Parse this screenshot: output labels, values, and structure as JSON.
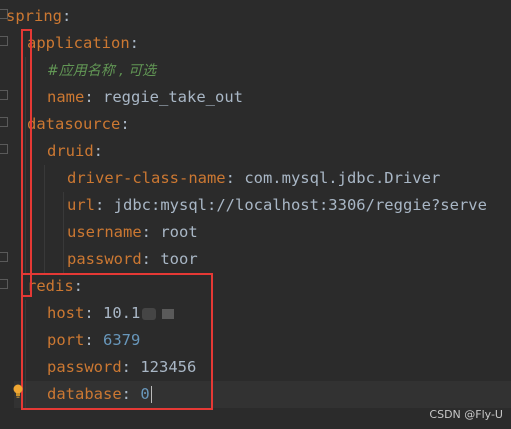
{
  "lines": {
    "spring": {
      "key": "spring",
      "sep": ":"
    },
    "application": {
      "key": "application",
      "sep": ":"
    },
    "comment": "#应用名称 , 可选",
    "name": {
      "key": "name",
      "sep": ": ",
      "value": "reggie_take_out"
    },
    "datasource": {
      "key": "datasource",
      "sep": ":"
    },
    "druid": {
      "key": "druid",
      "sep": ":"
    },
    "driver": {
      "key": "driver-class-name",
      "sep": ": ",
      "value": "com.mysql.jdbc.Driver"
    },
    "url": {
      "key": "url",
      "sep": ": ",
      "value": "jdbc:mysql://localhost:3306/reggie?serve"
    },
    "username": {
      "key": "username",
      "sep": ": ",
      "value": "root"
    },
    "ds_password": {
      "key": "password",
      "sep": ": ",
      "value": "toor"
    },
    "redis": {
      "key": "redis",
      "sep": ":"
    },
    "host": {
      "key": "host",
      "sep": ": ",
      "value": "10.1"
    },
    "port": {
      "key": "port",
      "sep": ": ",
      "value": "6379"
    },
    "redis_password": {
      "key": "password",
      "sep": ": ",
      "value": "123456"
    },
    "database": {
      "key": "database",
      "sep": ": ",
      "value": "0"
    }
  },
  "watermark": "CSDN @Fly-U",
  "colors": {
    "key": "#cc7832",
    "number": "#6897bb",
    "comment": "#629755",
    "highlight_box": "#e53935"
  },
  "icons": {
    "intention": "lightbulb-icon"
  }
}
